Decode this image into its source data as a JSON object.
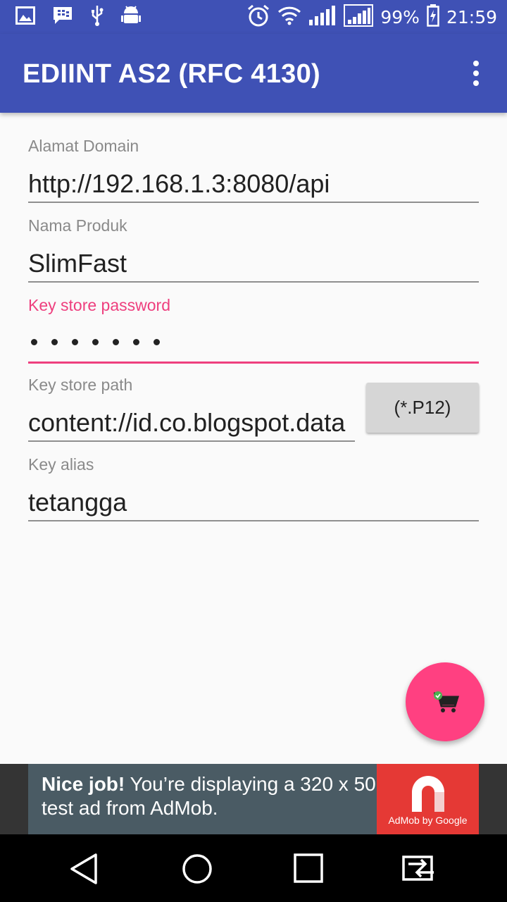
{
  "status_bar": {
    "battery_percent": "99%",
    "time": "21:59",
    "left_icons": [
      "gallery-icon",
      "bbm-icon",
      "usb-icon",
      "android-debug-icon"
    ],
    "right_icons": [
      "alarm-icon",
      "wifi-icon",
      "signal-1-icon",
      "signal-2-icon",
      "battery-charging-icon"
    ]
  },
  "app_bar": {
    "title": "EDIINT AS2 (RFC 4130)"
  },
  "form": {
    "domain": {
      "label": "Alamat Domain",
      "value": "http://192.168.1.3:8080/api"
    },
    "product": {
      "label": "Nama Produk",
      "value": "SlimFast"
    },
    "keystore_password": {
      "label": "Key store password",
      "masked_length": 7,
      "focused": true
    },
    "keystore_path": {
      "label": "Key store path",
      "value": "content://id.co.blogspot.data",
      "button_label": "(*.P12)"
    },
    "key_alias": {
      "label": "Key alias",
      "value": "tetangga"
    }
  },
  "fab": {
    "icon": "cart-icon"
  },
  "ad": {
    "bold_text": "Nice job!",
    "text": " You’re displaying a 320 x 50 test ad from AdMob.",
    "logo_text": "AdMob by Google"
  },
  "nav_bar": {
    "icons": [
      "back-icon",
      "home-icon",
      "recents-icon",
      "switch-icon"
    ]
  },
  "colors": {
    "primary": "#3f51b5",
    "accent": "#ff4081",
    "focused_label": "#ee3f7e",
    "ad_background": "#4a5b64",
    "ad_logo": "#e53935"
  }
}
